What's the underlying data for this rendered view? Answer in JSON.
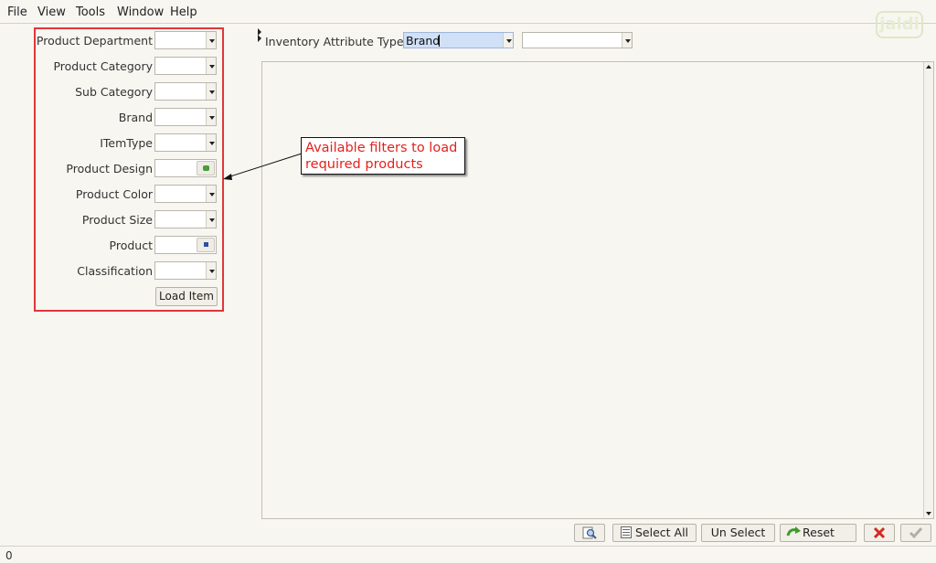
{
  "menu": {
    "items": [
      "File",
      "View",
      "Tools",
      "Window",
      "Help"
    ]
  },
  "logo": {
    "text": "jaldi"
  },
  "filters": {
    "rows": [
      {
        "label": "Product Department",
        "control": "combo"
      },
      {
        "label": "Product Category",
        "control": "combo"
      },
      {
        "label": "Sub Category",
        "control": "combo"
      },
      {
        "label": "Brand",
        "control": "combo"
      },
      {
        "label": "ITemType",
        "control": "combo"
      },
      {
        "label": "Product Design",
        "control": "picker"
      },
      {
        "label": "Product Color",
        "control": "combo"
      },
      {
        "label": "Product Size",
        "control": "combo"
      },
      {
        "label": "Product",
        "control": "picker"
      },
      {
        "label": "Classification",
        "control": "combo"
      }
    ],
    "load_button": "Load Item"
  },
  "inventory": {
    "label": "Inventory Attribute Type",
    "type_value": "Brand",
    "second_value": ""
  },
  "callout": {
    "line1": "Available filters to load",
    "line2": "required products",
    "color": "#e3221c"
  },
  "toolbar": {
    "find_icon": "magnifier-icon",
    "select_all": "Select All",
    "un_select": "Un Select",
    "reset": "Reset",
    "cancel_icon": "red-x-icon",
    "ok_icon": "checkmark-icon"
  },
  "status": {
    "text": "0"
  },
  "colors": {
    "highlight_border": "#e0363b",
    "selected_field": "#cfe0f7"
  }
}
